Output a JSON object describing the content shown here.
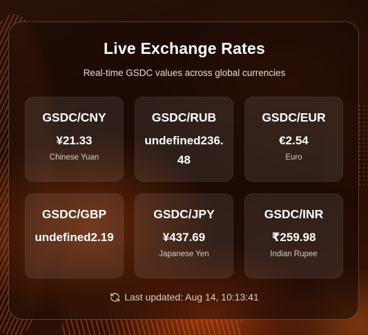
{
  "header": {
    "title": "Live Exchange Rates",
    "subtitle": "Real-time GSDC values across global currencies"
  },
  "rates": [
    {
      "pair": "GSDC/CNY",
      "value": "¥21.33",
      "name": "Chinese Yuan"
    },
    {
      "pair": "GSDC/RUB",
      "value": "undefined236.48",
      "name": ""
    },
    {
      "pair": "GSDC/EUR",
      "value": "€2.54",
      "name": "Euro"
    },
    {
      "pair": "GSDC/GBP",
      "value": "undefined2.19",
      "name": ""
    },
    {
      "pair": "GSDC/JPY",
      "value": "¥437.69",
      "name": "Japanese Yen"
    },
    {
      "pair": "GSDC/INR",
      "value": "₹259.98",
      "name": "Indian Rupee"
    }
  ],
  "footer": {
    "icon": "refresh-icon",
    "last_updated": "Last updated: Aug 14, 10:13:41"
  },
  "colors": {
    "accent": "#e65a14",
    "text": "#ffffff",
    "muted": "#d8ccc5"
  }
}
